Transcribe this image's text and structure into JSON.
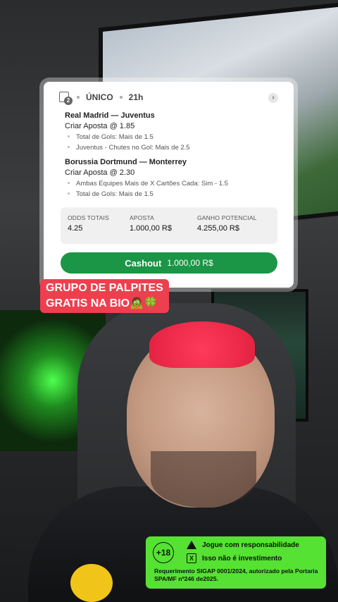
{
  "bet_card": {
    "ticket_count": "2",
    "bet_type": "ÚNICO",
    "time_ago": "21h",
    "matches": [
      {
        "title": "Real Madrid — Juventus",
        "market": "Criar Aposta @ 1.85",
        "selections": [
          "Total de Gols: Mais de 1.5",
          "Juventus - Chutes no Gol: Mais de 2.5"
        ]
      },
      {
        "title": "Borussia Dortmund — Monterrey",
        "market": "Criar Aposta @ 2.30",
        "selections": [
          "Ambas Equipes Mais de X Cartões Cada: Sim - 1.5",
          "Total de Gols: Mais de 1.5"
        ]
      }
    ],
    "summary": {
      "odds_label": "ODDS TOTAIS",
      "odds_value": "4.25",
      "stake_label": "APOSTA",
      "stake_value": "1.000,00 R$",
      "payout_label": "GANHO POTENCIAL",
      "payout_value": "4.255,00 R$"
    },
    "cashout_label": "Cashout",
    "cashout_amount": "1.000,00 R$"
  },
  "promo": {
    "line1": "GRUPO DE PALPITES",
    "line2": "GRATIS NA BIO🧟🍀"
  },
  "legal": {
    "age": "+18",
    "responsible": "Jogue com responsabilidade",
    "not_investment": "Isso não é investimento",
    "note": "Requerimento SIGAP 0001/2024, autorizado pela Portaria SPA/MF nº246 de2025."
  },
  "colors": {
    "cashout_green": "#1a9646",
    "promo_red": "#ee3f4f",
    "legal_green": "#55e233"
  }
}
